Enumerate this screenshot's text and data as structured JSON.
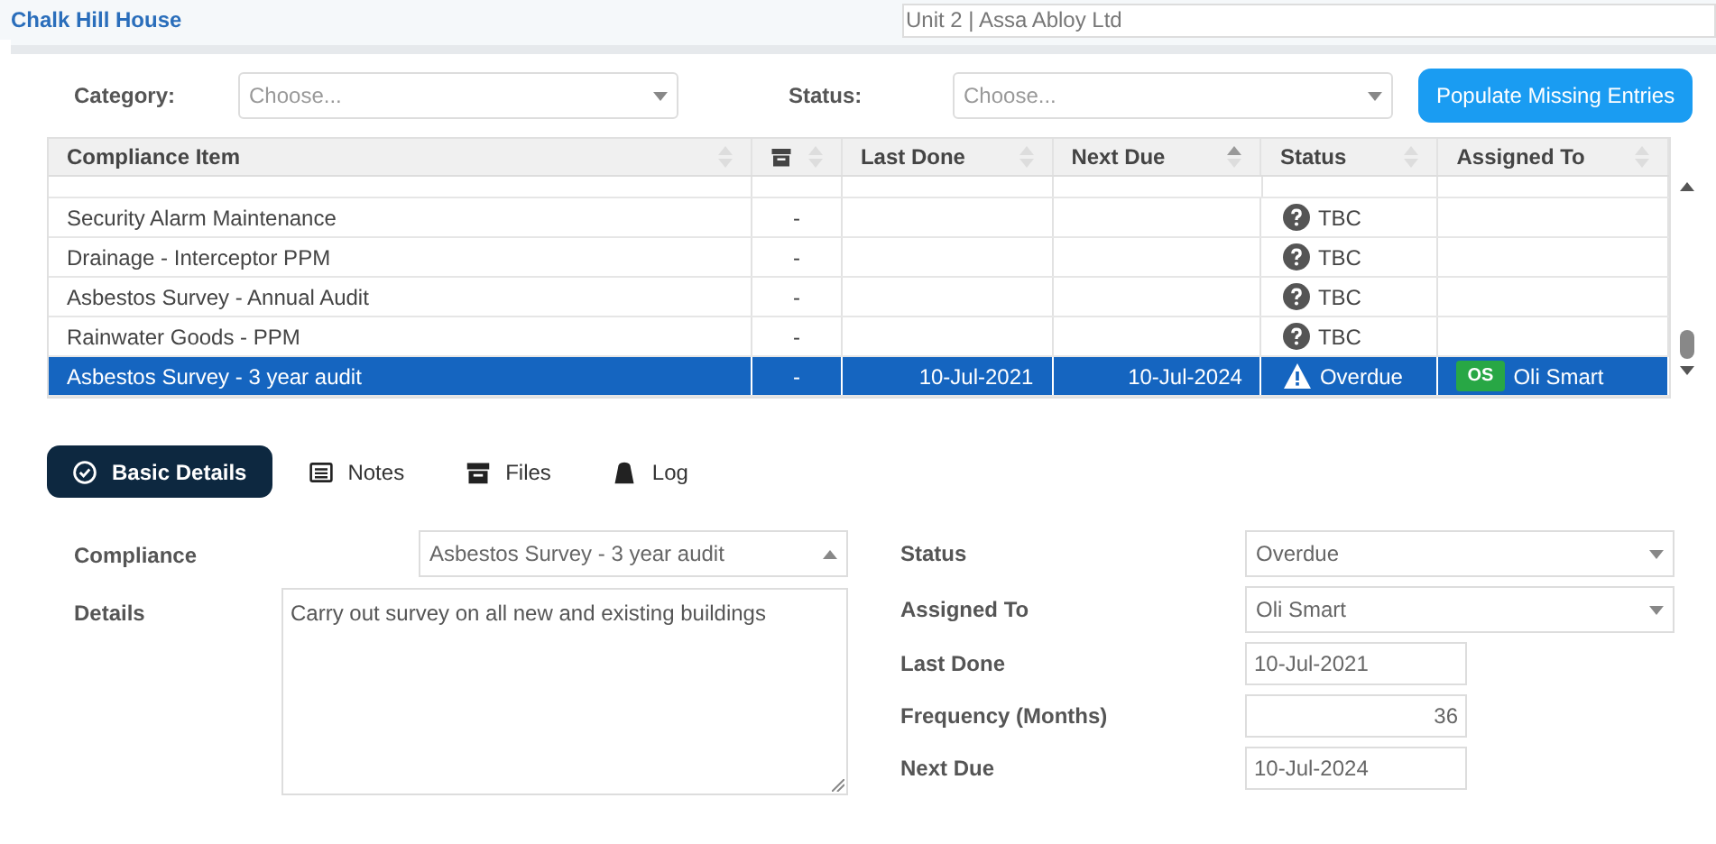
{
  "header": {
    "title": "Chalk Hill House",
    "unit_field": "Unit 2 | Assa Abloy Ltd"
  },
  "filters": [
    {
      "label": "Category:",
      "placeholder": "Choose..."
    },
    {
      "label": "Status:",
      "placeholder": "Choose..."
    }
  ],
  "populate_button": "Populate Missing Entries",
  "table": {
    "columns": [
      {
        "label": "Compliance Item",
        "kind": "text",
        "sorted": false
      },
      {
        "kind": "archive",
        "sorted": false
      },
      {
        "label": "Last Done",
        "kind": "text",
        "sorted": false
      },
      {
        "label": "Next Due",
        "kind": "text",
        "sorted": true
      },
      {
        "label": "Status",
        "kind": "text",
        "sorted": false
      },
      {
        "label": "Assigned To",
        "kind": "text",
        "sorted": false
      }
    ],
    "rows": [
      {
        "item": "Security Alarm Maintenance",
        "archive": "-",
        "status": {
          "kind": "tbc",
          "text": "TBC"
        },
        "selected": false
      },
      {
        "item": "Drainage - Interceptor PPM",
        "archive": "-",
        "status": {
          "kind": "tbc",
          "text": "TBC"
        },
        "selected": false
      },
      {
        "item": "Asbestos Survey - Annual Audit",
        "archive": "-",
        "status": {
          "kind": "tbc",
          "text": "TBC"
        },
        "selected": false
      },
      {
        "item": "Rainwater Goods - PPM",
        "archive": "-",
        "status": {
          "kind": "tbc",
          "text": "TBC"
        },
        "selected": false
      },
      {
        "item": "Asbestos Survey - 3 year audit",
        "archive": "-",
        "last_done": "10-Jul-2021",
        "next_due": "10-Jul-2024",
        "status": {
          "kind": "overdue",
          "text": "Overdue"
        },
        "assigned": {
          "initials": "OS",
          "name": "Oli Smart"
        },
        "selected": true
      }
    ]
  },
  "tabs": [
    {
      "label": "Basic Details",
      "selected": true
    },
    {
      "label": "Notes",
      "selected": false
    },
    {
      "label": "Files",
      "selected": false
    },
    {
      "label": "Log",
      "selected": false
    }
  ],
  "form_left": [
    {
      "label": "Compliance",
      "kind": "select",
      "value": "Asbestos Survey - 3 year audit",
      "expanded": true
    },
    {
      "label": "Details",
      "kind": "textarea",
      "value": "Carry out survey on all new and existing buildings"
    }
  ],
  "form_right": [
    {
      "label": "Status",
      "kind": "select",
      "value": "Overdue",
      "expanded": false
    },
    {
      "label": "Assigned To",
      "kind": "select",
      "value": "Oli Smart",
      "expanded": false
    },
    {
      "label": "Last Done",
      "kind": "date",
      "value": "10-Jul-2021"
    },
    {
      "label": "Frequency (Months)",
      "kind": "number",
      "value": "36"
    },
    {
      "label": "Next Due",
      "kind": "date",
      "value": "10-Jul-2024"
    }
  ]
}
